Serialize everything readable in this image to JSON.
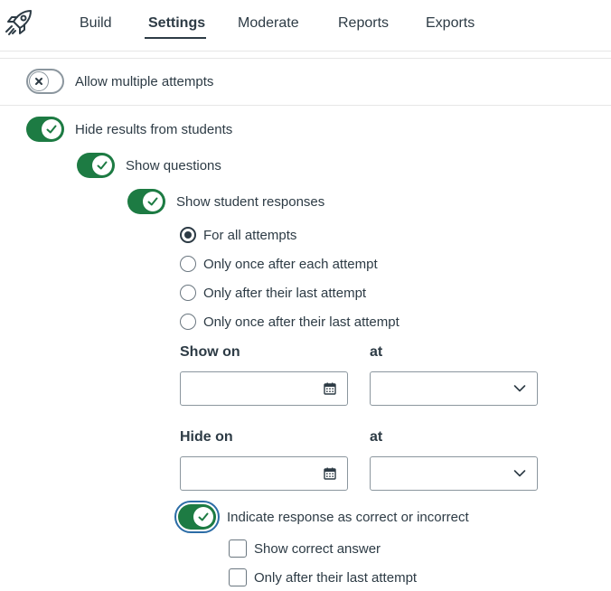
{
  "nav": {
    "logo_icon": "rocket-icon",
    "tabs": [
      {
        "label": "Build",
        "active": false
      },
      {
        "label": "Settings",
        "active": true
      },
      {
        "label": "Moderate",
        "active": false
      },
      {
        "label": "Reports",
        "active": false
      },
      {
        "label": "Exports",
        "active": false
      }
    ]
  },
  "settings": {
    "allow_multiple_attempts": {
      "label": "Allow multiple attempts",
      "on": false
    },
    "hide_results": {
      "label": "Hide results from students",
      "on": true
    },
    "show_questions": {
      "label": "Show questions",
      "on": true
    },
    "show_student_responses": {
      "label": "Show student responses",
      "on": true
    },
    "response_timing": {
      "selected": 0,
      "options": [
        "For all attempts",
        "Only once after each attempt",
        "Only after their last attempt",
        "Only once after their last attempt"
      ]
    },
    "show_on": {
      "label": "Show on",
      "at_label": "at",
      "date_value": "",
      "time_value": ""
    },
    "hide_on": {
      "label": "Hide on",
      "at_label": "at",
      "date_value": "",
      "time_value": ""
    },
    "indicate_correct": {
      "label": "Indicate response as correct or incorrect",
      "on": true
    },
    "show_correct_answer": {
      "label": "Show correct answer",
      "checked": false
    },
    "only_after_last_attempt": {
      "label": "Only after their last attempt",
      "checked": false
    }
  },
  "colors": {
    "toggle_on": "#1d7b43",
    "text": "#2d3b45",
    "border": "#8b969e",
    "focus": "#2b6ca6"
  }
}
